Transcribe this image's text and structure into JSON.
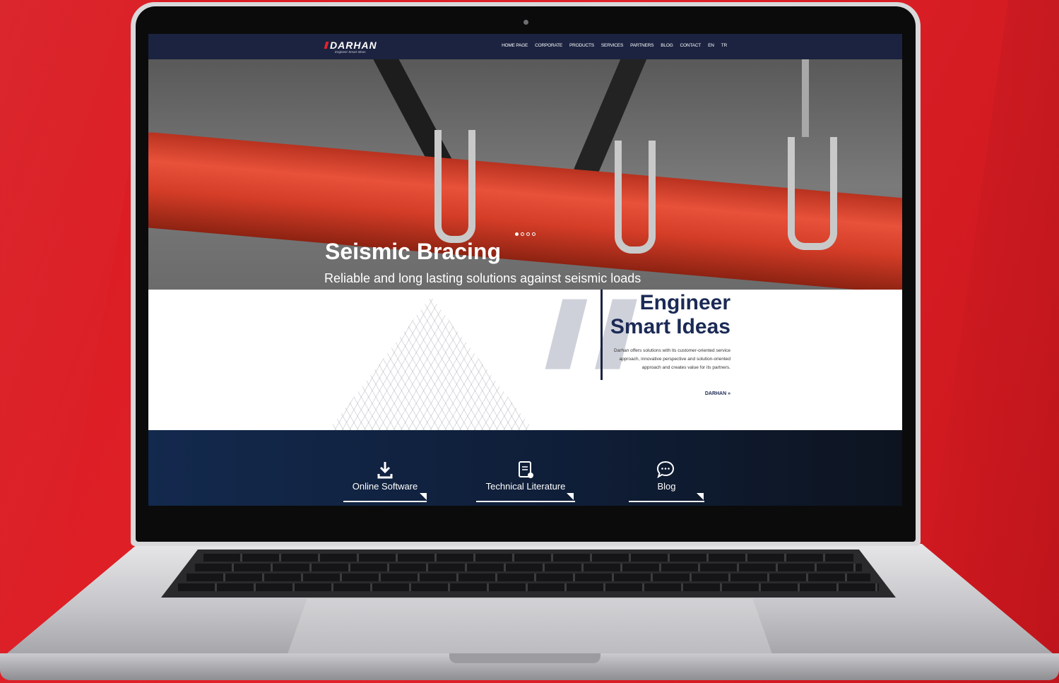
{
  "site": {
    "logo_text": "DARHAN",
    "logo_tagline": "Engineer Smart Ideas",
    "nav": [
      "HOME PAGE",
      "CORPORATE",
      "PRODUCTS",
      "SERVICES",
      "PARTNERS",
      "BLOG",
      "CONTACT",
      "EN",
      "TR"
    ]
  },
  "hero": {
    "title": "Seismic Bracing",
    "subtitle": "Reliable and long lasting solutions against seismic loads",
    "slide_count": 4,
    "active_slide": 1
  },
  "about": {
    "title_line1": "Engineer",
    "title_line2": "Smart Ideas",
    "body": "Darhan offers solutions with its customer-oriented service approach, innovative perspective and solution-oriented approach and creates value for its partners.",
    "link": "DARHAN »"
  },
  "features": [
    {
      "label": "Online Software",
      "icon": "download-icon"
    },
    {
      "label": "Technical Literature",
      "icon": "document-icon"
    },
    {
      "label": "Blog",
      "icon": "chat-icon"
    }
  ],
  "colors": {
    "brand_red": "#e2232a",
    "navy": "#1b2340",
    "heading_navy": "#1b2a55"
  }
}
